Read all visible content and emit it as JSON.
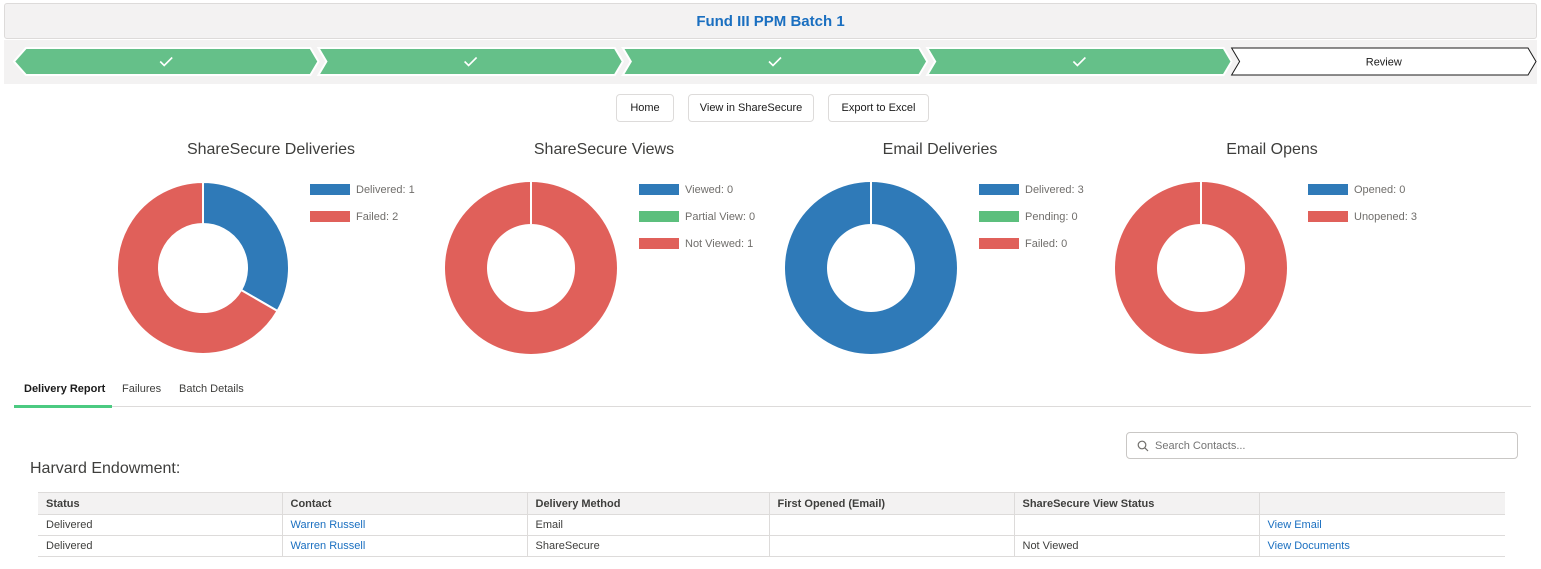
{
  "header": {
    "title": "Fund III PPM Batch 1"
  },
  "path": {
    "steps": [
      {
        "label": "",
        "state": "complete"
      },
      {
        "label": "",
        "state": "complete"
      },
      {
        "label": "",
        "state": "complete"
      },
      {
        "label": "",
        "state": "complete"
      },
      {
        "label": "Review",
        "state": "current"
      }
    ],
    "complete_color": "#65c089"
  },
  "actions": {
    "home_label": "Home",
    "view_sharesecure_label": "View in ShareSecure",
    "export_label": "Export to Excel"
  },
  "charts": [
    {
      "title": "ShareSecure Deliveries",
      "legend": [
        {
          "label": "Delivered: 1",
          "color": "#2f7ab8",
          "value": 1
        },
        {
          "label": "Failed: 2",
          "color": "#e0605a",
          "value": 2
        }
      ]
    },
    {
      "title": "ShareSecure Views",
      "legend": [
        {
          "label": "Viewed: 0",
          "color": "#2f7ab8",
          "value": 0
        },
        {
          "label": "Partial View: 0",
          "color": "#5cbf7d",
          "value": 0
        },
        {
          "label": "Not Viewed: 1",
          "color": "#e0605a",
          "value": 1
        }
      ]
    },
    {
      "title": "Email Deliveries",
      "legend": [
        {
          "label": "Delivered: 3",
          "color": "#2f7ab8",
          "value": 3
        },
        {
          "label": "Pending: 0",
          "color": "#5cbf7d",
          "value": 0
        },
        {
          "label": "Failed: 0",
          "color": "#e0605a",
          "value": 0
        }
      ]
    },
    {
      "title": "Email Opens",
      "legend": [
        {
          "label": "Opened: 0",
          "color": "#2f7ab8",
          "value": 0
        },
        {
          "label": "Unopened: 3",
          "color": "#e0605a",
          "value": 3
        }
      ]
    }
  ],
  "tabs": [
    {
      "label": "Delivery Report",
      "active": true
    },
    {
      "label": "Failures",
      "active": false
    },
    {
      "label": "Batch Details",
      "active": false
    }
  ],
  "search": {
    "placeholder": "Search Contacts..."
  },
  "section": {
    "title": "Harvard Endowment:"
  },
  "table": {
    "columns": [
      "Status",
      "Contact",
      "Delivery Method",
      "First Opened (Email)",
      "ShareSecure View Status",
      ""
    ],
    "rows": [
      [
        "Delivered",
        "Warren Russell",
        "Email",
        "",
        "",
        "View Email"
      ],
      [
        "Delivered",
        "Warren Russell",
        "ShareSecure",
        "",
        "Not Viewed",
        "View Documents"
      ]
    ]
  }
}
